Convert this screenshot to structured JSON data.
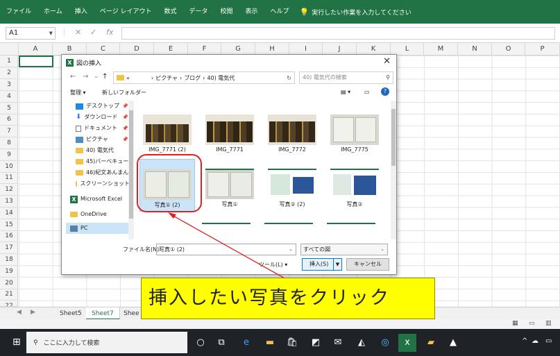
{
  "ribbon": {
    "tabs": [
      "ファイル",
      "ホーム",
      "挿入",
      "ページ レイアウト",
      "数式",
      "データ",
      "校閲",
      "表示",
      "ヘルプ"
    ],
    "tell_me": "実行したい作業を入力してください"
  },
  "formula_bar": {
    "name_box": "A1",
    "fx": "fx"
  },
  "columns": [
    "A",
    "B",
    "C",
    "D",
    "E",
    "F",
    "G",
    "H",
    "I",
    "J",
    "K",
    "L",
    "M",
    "N",
    "O",
    "P"
  ],
  "rows": [
    "1",
    "2",
    "3",
    "4",
    "5",
    "6",
    "7",
    "8",
    "9",
    "10",
    "11",
    "12",
    "13",
    "14",
    "15",
    "16",
    "17",
    "18",
    "19",
    "20",
    "21",
    "22"
  ],
  "sheets": {
    "tabs": [
      "Sheet5",
      "Sheet7",
      "Shee"
    ],
    "active": "Sheet7"
  },
  "taskbar": {
    "search_placeholder": "ここに入力して検索"
  },
  "dialog": {
    "title": "図の挿入",
    "address": {
      "prefix": "«",
      "path": [
        "ピクチャ",
        "ブログ",
        "40) 電気代"
      ]
    },
    "search_placeholder": "40) 電気代の検索",
    "toolbar": {
      "organize": "整理 ▾",
      "new_folder": "新しいフォルダー"
    },
    "nav_items": [
      {
        "label": "デスクトップ",
        "icon": "desktop-icon",
        "pinned": true
      },
      {
        "label": "ダウンロード",
        "icon": "download-icon",
        "pinned": true
      },
      {
        "label": "ドキュメント",
        "icon": "document-icon",
        "pinned": true
      },
      {
        "label": "ピクチャ",
        "icon": "picture-icon",
        "pinned": true
      },
      {
        "label": "40) 電気代",
        "icon": "folder-icon",
        "pinned": false
      },
      {
        "label": "45)バーベキュー",
        "icon": "folder-icon",
        "pinned": false
      },
      {
        "label": "46)紀文あんまん",
        "icon": "folder-icon",
        "pinned": false
      },
      {
        "label": "スクリーンショット",
        "icon": "folder-icon",
        "pinned": false
      },
      {
        "label": "Microsoft Excel",
        "icon": "excel-icon",
        "pinned": false
      },
      {
        "label": "OneDrive",
        "icon": "folder-icon",
        "pinned": false
      },
      {
        "label": "PC",
        "icon": "pc-icon",
        "pinned": false,
        "selected": true
      }
    ],
    "files": [
      {
        "name": "IMG_7771 (2)",
        "kind": "bottles"
      },
      {
        "name": "IMG_7771",
        "kind": "bottles"
      },
      {
        "name": "IMG_7772",
        "kind": "bottles"
      },
      {
        "name": "IMG_7775",
        "kind": "paper"
      },
      {
        "name": "写真① (2)",
        "kind": "paper",
        "selected": true
      },
      {
        "name": "写真①",
        "kind": "paper"
      },
      {
        "name": "写真② (2)",
        "kind": "screen"
      },
      {
        "name": "写真②",
        "kind": "screen"
      }
    ],
    "filename_label": "ファイル名(N):",
    "filename_value": "写真① (2)",
    "filetype": "すべての図",
    "tools_label": "ツール(L)",
    "insert_label": "挿入(S)",
    "cancel_label": "キャンセル"
  },
  "annotation": {
    "text": "挿入したい写真をクリック",
    "color": "#e02020",
    "callout_bg": "#ffff00"
  },
  "colors": {
    "excel_green": "#217346",
    "selection_blue": "#cce4f7"
  }
}
